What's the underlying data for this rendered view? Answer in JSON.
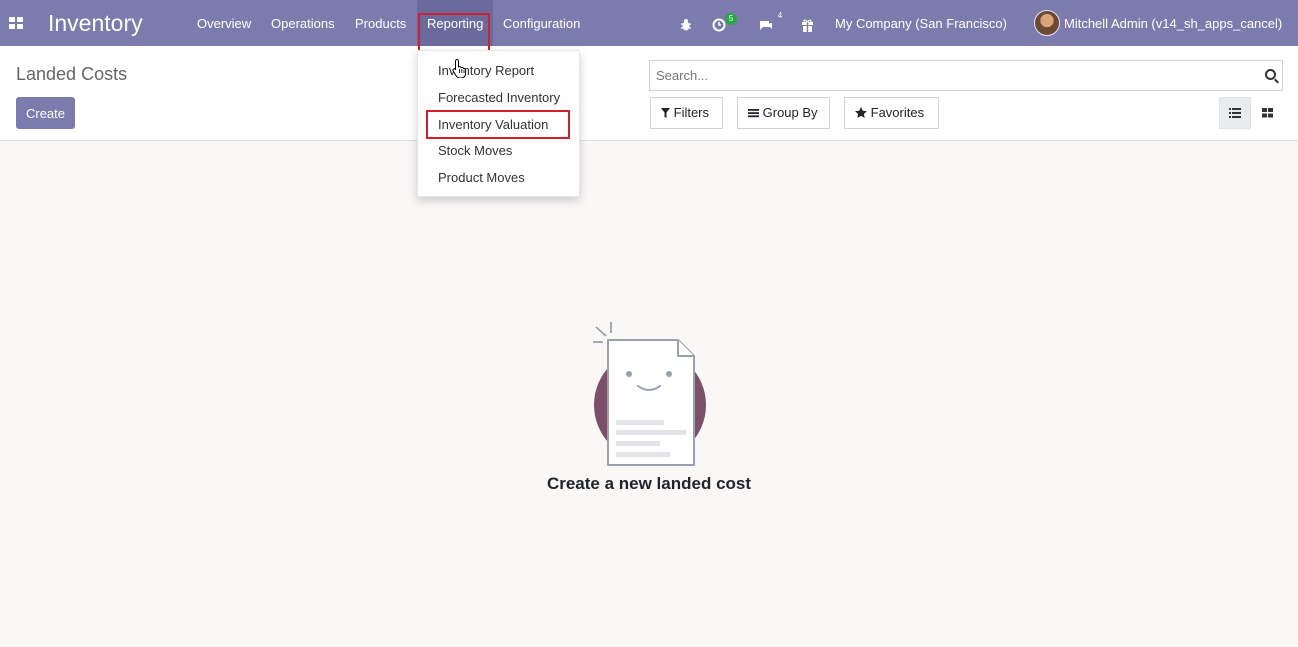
{
  "navbar": {
    "app_name": "Inventory",
    "menu": [
      {
        "label": "Overview"
      },
      {
        "label": "Operations"
      },
      {
        "label": "Products"
      },
      {
        "label": "Reporting",
        "active": true
      },
      {
        "label": "Configuration"
      }
    ],
    "systray": {
      "activity_badge": "5",
      "messages_badge": "4",
      "company": "My Company (San Francisco)",
      "user": "Mitchell Admin (v14_sh_apps_cancel)"
    },
    "icons": [
      "apps-grid-icon",
      "bug-icon",
      "activity-clock-icon",
      "chat-icon",
      "gift-icon",
      "user-avatar"
    ]
  },
  "control_panel": {
    "breadcrumb": "Landed Costs",
    "create_label": "Create",
    "search_placeholder": "Search...",
    "filters_label": "Filters",
    "group_by_label": "Group By",
    "favorites_label": "Favorites"
  },
  "reporting_dropdown": {
    "items": [
      {
        "label": "Inventory Report"
      },
      {
        "label": "Forecasted Inventory"
      },
      {
        "label": "Inventory Valuation",
        "highlighted": true
      },
      {
        "label": "Stock Moves"
      },
      {
        "label": "Product Moves"
      }
    ]
  },
  "empty_state": {
    "title": "Create a new landed cost"
  },
  "colors": {
    "brand": "#7c7bad",
    "highlight": "#d21f2b"
  }
}
